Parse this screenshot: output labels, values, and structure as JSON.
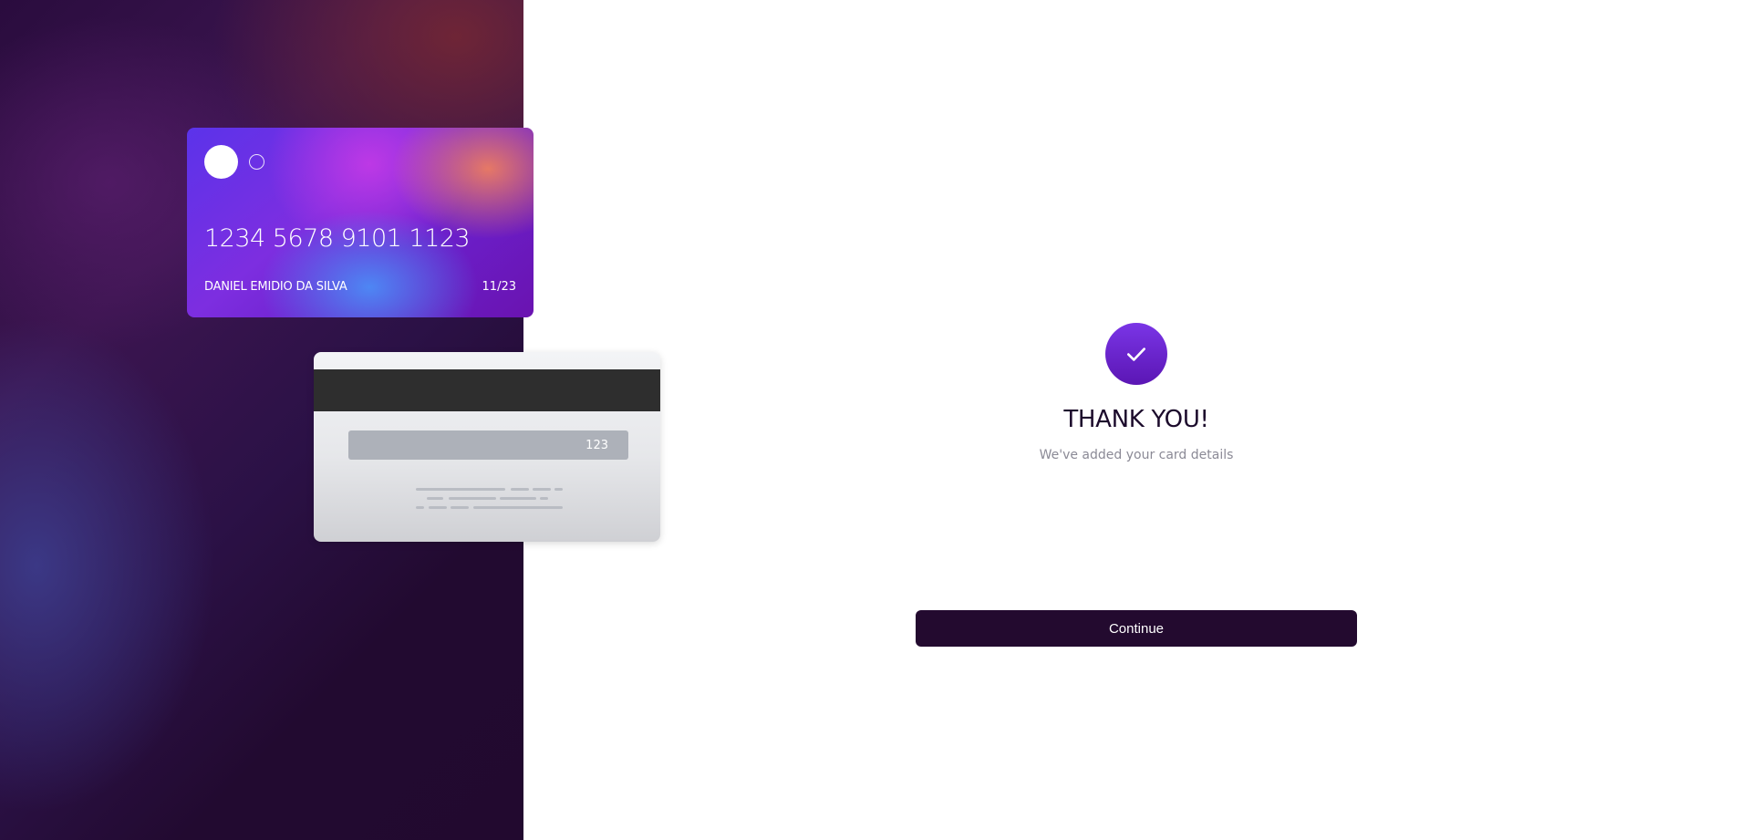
{
  "card_front": {
    "number": "1234 5678 9101 1123",
    "holder": "DANIEL EMIDIO DA SILVA",
    "expiry": "11/23"
  },
  "card_back": {
    "cvv": "123"
  },
  "confirmation": {
    "icon": "checkmark-icon",
    "title": "THANK YOU!",
    "subtitle": "We've added your card details"
  },
  "actions": {
    "continue_label": "Continue"
  },
  "colors": {
    "accent": "#6a25cc",
    "button": "#230a2f",
    "title": "#1c0b2c",
    "muted": "#8b8a96"
  }
}
